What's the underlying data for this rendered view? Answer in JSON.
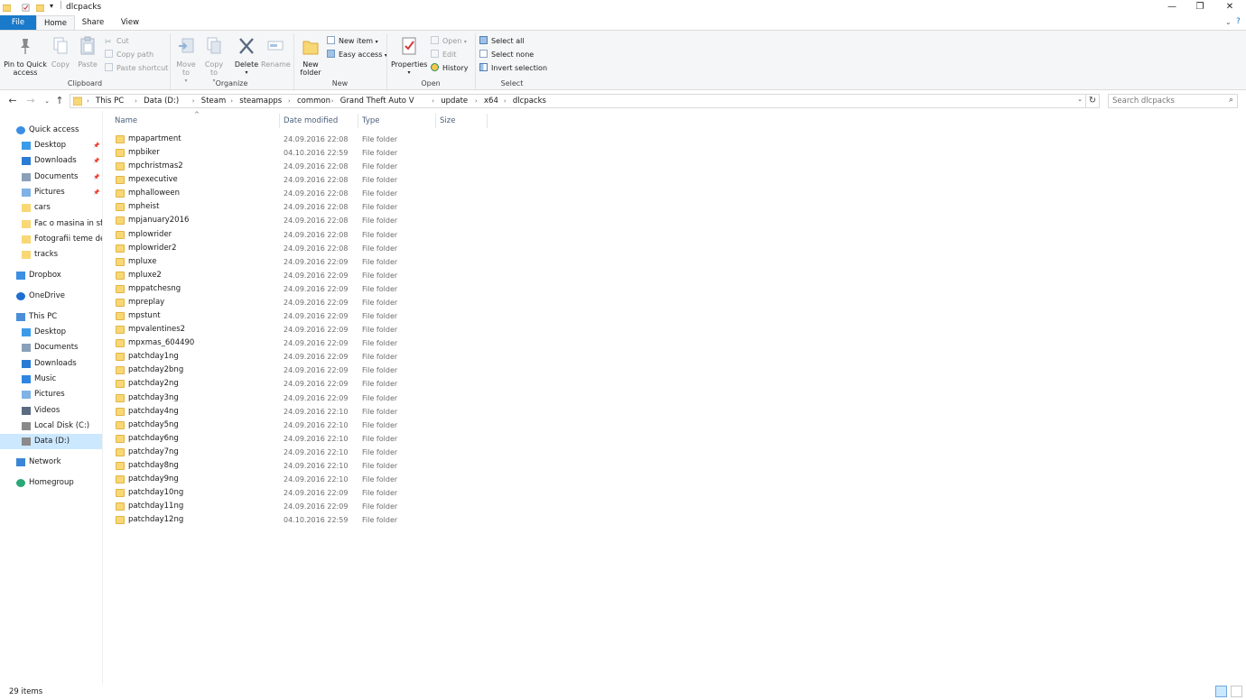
{
  "window": {
    "title": "dlcpacks",
    "minimize_icon": "minimize-icon",
    "maximize_icon": "restore-icon",
    "close_icon": "close-icon"
  },
  "ribbon_tabs": [
    "File",
    "Home",
    "Share",
    "View"
  ],
  "ribbon": {
    "clipboard": {
      "label": "Clipboard",
      "pin_to_quick_access": "Pin to Quick access",
      "copy": "Copy",
      "paste": "Paste",
      "cut": "Cut",
      "copy_path": "Copy path",
      "paste_shortcut": "Paste shortcut"
    },
    "organize": {
      "label": "Organize",
      "move_to": "Move to",
      "copy_to": "Copy to",
      "delete": "Delete",
      "rename": "Rename"
    },
    "new": {
      "label": "New",
      "new_folder": "New folder",
      "new_item": "New item",
      "easy_access": "Easy access"
    },
    "open": {
      "label": "Open",
      "properties": "Properties",
      "open": "Open",
      "edit": "Edit",
      "history": "History"
    },
    "select": {
      "label": "Select",
      "select_all": "Select all",
      "select_none": "Select none",
      "invert_selection": "Invert selection"
    }
  },
  "breadcrumb": [
    "This PC",
    "Data (D:)",
    "Steam",
    "steamapps",
    "common",
    "Grand Theft Auto V",
    "update",
    "x64",
    "dlcpacks"
  ],
  "search": {
    "placeholder": "Search dlcpacks"
  },
  "nav_pane": {
    "quick_access": "Quick access",
    "quick_items": [
      {
        "label": "Desktop",
        "pinned": true
      },
      {
        "label": "Downloads",
        "pinned": true
      },
      {
        "label": "Documents",
        "pinned": true
      },
      {
        "label": "Pictures",
        "pinned": true
      },
      {
        "label": "cars",
        "pinned": false
      },
      {
        "label": "Fac o masina in sfar",
        "pinned": false
      },
      {
        "label": "Fotografii teme de v",
        "pinned": false
      },
      {
        "label": "tracks",
        "pinned": false
      }
    ],
    "dropbox": "Dropbox",
    "onedrive": "OneDrive",
    "this_pc": "This PC",
    "pc_items": [
      "Desktop",
      "Documents",
      "Downloads",
      "Music",
      "Pictures",
      "Videos",
      "Local Disk (C:)",
      "Data (D:)"
    ],
    "network": "Network",
    "homegroup": "Homegroup"
  },
  "columns": {
    "name": "Name",
    "date_modified": "Date modified",
    "type": "Type",
    "size": "Size"
  },
  "files": [
    {
      "name": "mpapartment",
      "date": "24.09.2016 22:08",
      "type": "File folder"
    },
    {
      "name": "mpbiker",
      "date": "04.10.2016 22:59",
      "type": "File folder"
    },
    {
      "name": "mpchristmas2",
      "date": "24.09.2016 22:08",
      "type": "File folder"
    },
    {
      "name": "mpexecutive",
      "date": "24.09.2016 22:08",
      "type": "File folder"
    },
    {
      "name": "mphalloween",
      "date": "24.09.2016 22:08",
      "type": "File folder"
    },
    {
      "name": "mpheist",
      "date": "24.09.2016 22:08",
      "type": "File folder"
    },
    {
      "name": "mpjanuary2016",
      "date": "24.09.2016 22:08",
      "type": "File folder"
    },
    {
      "name": "mplowrider",
      "date": "24.09.2016 22:08",
      "type": "File folder"
    },
    {
      "name": "mplowrider2",
      "date": "24.09.2016 22:08",
      "type": "File folder"
    },
    {
      "name": "mpluxe",
      "date": "24.09.2016 22:09",
      "type": "File folder"
    },
    {
      "name": "mpluxe2",
      "date": "24.09.2016 22:09",
      "type": "File folder"
    },
    {
      "name": "mppatchesng",
      "date": "24.09.2016 22:09",
      "type": "File folder"
    },
    {
      "name": "mpreplay",
      "date": "24.09.2016 22:09",
      "type": "File folder"
    },
    {
      "name": "mpstunt",
      "date": "24.09.2016 22:09",
      "type": "File folder"
    },
    {
      "name": "mpvalentines2",
      "date": "24.09.2016 22:09",
      "type": "File folder"
    },
    {
      "name": "mpxmas_604490",
      "date": "24.09.2016 22:09",
      "type": "File folder"
    },
    {
      "name": "patchday1ng",
      "date": "24.09.2016 22:09",
      "type": "File folder"
    },
    {
      "name": "patchday2bng",
      "date": "24.09.2016 22:09",
      "type": "File folder"
    },
    {
      "name": "patchday2ng",
      "date": "24.09.2016 22:09",
      "type": "File folder"
    },
    {
      "name": "patchday3ng",
      "date": "24.09.2016 22:09",
      "type": "File folder"
    },
    {
      "name": "patchday4ng",
      "date": "24.09.2016 22:10",
      "type": "File folder"
    },
    {
      "name": "patchday5ng",
      "date": "24.09.2016 22:10",
      "type": "File folder"
    },
    {
      "name": "patchday6ng",
      "date": "24.09.2016 22:10",
      "type": "File folder"
    },
    {
      "name": "patchday7ng",
      "date": "24.09.2016 22:10",
      "type": "File folder"
    },
    {
      "name": "patchday8ng",
      "date": "24.09.2016 22:10",
      "type": "File folder"
    },
    {
      "name": "patchday9ng",
      "date": "24.09.2016 22:10",
      "type": "File folder"
    },
    {
      "name": "patchday10ng",
      "date": "24.09.2016 22:09",
      "type": "File folder"
    },
    {
      "name": "patchday11ng",
      "date": "24.09.2016 22:09",
      "type": "File folder"
    },
    {
      "name": "patchday12ng",
      "date": "04.10.2016 22:59",
      "type": "File folder"
    }
  ],
  "status": {
    "item_count": "29 items"
  },
  "colors": {
    "accent": "#1979ca",
    "selection": "#cce8ff",
    "folder": "#f8d775"
  }
}
